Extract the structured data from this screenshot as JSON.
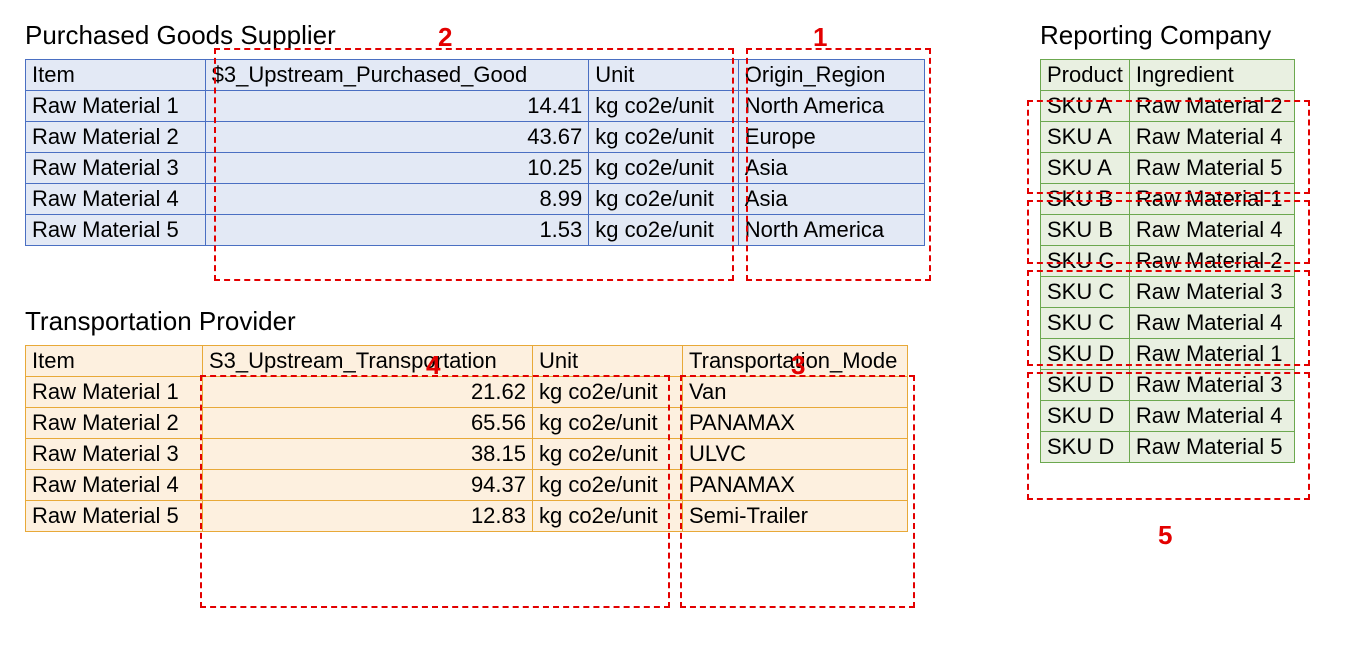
{
  "purchased": {
    "title": "Purchased Goods Supplier",
    "headers": [
      "Item",
      "$3_Upstream_Purchased_Good",
      "Unit",
      "Origin_Region"
    ],
    "rows": [
      [
        "Raw Material 1",
        "14.41",
        "kg co2e/unit",
        "North America"
      ],
      [
        "Raw Material 2",
        "43.67",
        "kg co2e/unit",
        "Europe"
      ],
      [
        "Raw Material 3",
        "10.25",
        "kg co2e/unit",
        "Asia"
      ],
      [
        "Raw Material 4",
        "8.99",
        "kg co2e/unit",
        "Asia"
      ],
      [
        "Raw Material 5",
        "1.53",
        "kg co2e/unit",
        "North America"
      ]
    ]
  },
  "transport": {
    "title": "Transportation Provider",
    "headers": [
      "Item",
      "S3_Upstream_Transportation",
      "Unit",
      "Transportation_Mode"
    ],
    "rows": [
      [
        "Raw Material 1",
        "21.62",
        "kg co2e/unit",
        "Van"
      ],
      [
        "Raw Material 2",
        "65.56",
        "kg co2e/unit",
        "PANAMAX"
      ],
      [
        "Raw Material 3",
        "38.15",
        "kg co2e/unit",
        "ULVC"
      ],
      [
        "Raw Material 4",
        "94.37",
        "kg co2e/unit",
        "PANAMAX"
      ],
      [
        "Raw Material 5",
        "12.83",
        "kg co2e/unit",
        "Semi-Trailer"
      ]
    ]
  },
  "reporting": {
    "title": "Reporting Company",
    "headers": [
      "Product",
      "Ingredient"
    ],
    "rows": [
      [
        "SKU A",
        "Raw Material 2"
      ],
      [
        "SKU A",
        "Raw Material 4"
      ],
      [
        "SKU A",
        "Raw Material 5"
      ],
      [
        "SKU B",
        "Raw Material 1"
      ],
      [
        "SKU B",
        "Raw Material 4"
      ],
      [
        "SKU C",
        "Raw Material 2"
      ],
      [
        "SKU C",
        "Raw Material 3"
      ],
      [
        "SKU C",
        "Raw Material 4"
      ],
      [
        "SKU D",
        "Raw Material 1"
      ],
      [
        "SKU D",
        "Raw Material 3"
      ],
      [
        "SKU D",
        "Raw Material 4"
      ],
      [
        "SKU D",
        "Raw Material 5"
      ]
    ]
  },
  "annot": {
    "l1": "1",
    "l2": "2",
    "l3": "3",
    "l4": "4",
    "l5": "5"
  }
}
